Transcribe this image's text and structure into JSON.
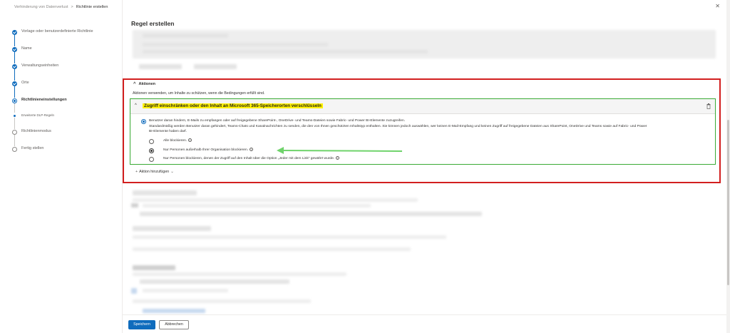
{
  "breadcrumb": {
    "parent": "Verhinderung von Datenverlust",
    "separator": ">",
    "current": "Richtlinie erstellen"
  },
  "wizard": {
    "steps": [
      {
        "label": "Vorlage oder benutzerdefinierte Richtlinie",
        "state": "done"
      },
      {
        "label": "Name",
        "state": "done"
      },
      {
        "label": "Verwaltungseinheiten",
        "state": "done"
      },
      {
        "label": "Orte",
        "state": "done"
      },
      {
        "label": "Richtlinieneinstellungen",
        "state": "current"
      },
      {
        "label": "Erweiterte DLP-Regeln",
        "state": "sub"
      },
      {
        "label": "Richtlinienmodus",
        "state": "todo"
      },
      {
        "label": "Fertig stellen",
        "state": "todo"
      }
    ]
  },
  "panel": {
    "title": "Regel erstellen",
    "close_icon": "close-icon"
  },
  "actions": {
    "header": "Aktionen",
    "description": "Aktionen verwenden, um Inhalte zu schützen, wenn die Bedingungen erfüllt sind.",
    "rule": {
      "title": "Zugriff einschränken oder den Inhalt an Microsoft 365-Speicherorten verschlüsseln",
      "main_option": "Benutzer daran hindern, E-Mails zu empfangen oder auf freigegebene SharePoint-, OneDrive- und Teams-Dateien sowie Fabric- und Power BI-Elemente zuzugreifen.",
      "explanation_line1": "Standardmäßig werden Benutzer daran gehindert, Teams-Chats und Kanalnachrichten zu senden, die den von Ihnen geschützten Inhaltstyp enthalten. Sie können jedoch auswählen, wer keinen E-Mail-Empfang und keinen Zugriff auf freigegebene Dateien aus SharePoint, OneDrive und Teams sowie auf Fabric- und Power",
      "explanation_line2": "BI-Elemente haben darf.",
      "options": [
        {
          "label": "Alle blockieren.",
          "selected": false
        },
        {
          "label": "Nur Personen außerhalb Ihrer Organisation blockieren.",
          "selected": true
        },
        {
          "label": "Nur Personen blockieren, denen der Zugriff auf den Inhalt über die Option „Jeder mit dem Link“ gewährt wurde.",
          "selected": false
        }
      ]
    },
    "add_action": "Aktion hinzufügen"
  },
  "footer": {
    "save": "Speichern",
    "cancel": "Abbrechen"
  },
  "colors": {
    "accent": "#0f6cbd",
    "highlight": "#fff200",
    "red_frame": "#d21f1f",
    "green_frame": "#3aaa35",
    "arrow": "#6fd36b"
  }
}
